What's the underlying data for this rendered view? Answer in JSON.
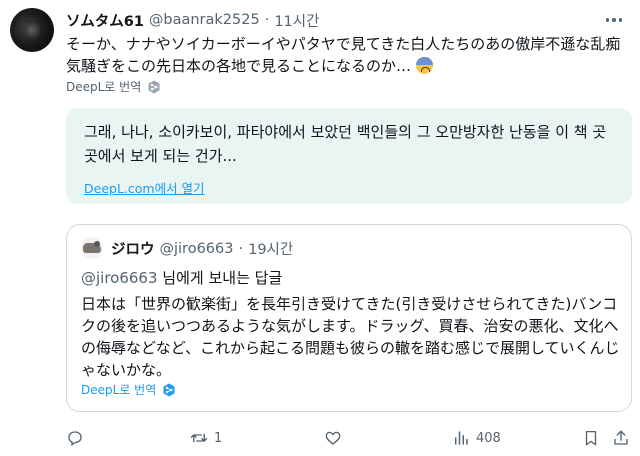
{
  "tweet": {
    "display_name": "ソムタム61",
    "handle": "@baanrak2525",
    "separator": "·",
    "time": "11시간",
    "text": "そーか、ナナやソイカーボーイやパタヤで見てきた白人たちのあの傲岸不遜な乱痴気騒ぎをこの先日本の各地で見ることになるのか…",
    "emoji": "worried-face",
    "translate_label": "DeepL로 번역"
  },
  "translation": {
    "text": "그래, 나나, 소이카보이, 파타야에서 보았던 백인들의 그 오만방자한 난동을 이 책 곳곳에서 보게 되는 건가...",
    "link_label": "DeepL.com에서 열기"
  },
  "quote": {
    "display_name": "ジロウ",
    "handle": "@jiro6663",
    "separator": "·",
    "time": "19시간",
    "reply_mention": "@jiro6663",
    "reply_suffix": " 님에게 보내는 답글",
    "text": "日本は「世界の歓楽街」を長年引き受けてきた(引き受けさせられてきた)バンコクの後を追いつつあるような気がします。ドラッグ、買春、治安の悪化、文化への侮辱などなど、これから起こる問題も彼らの轍を踏む感じで展開していくんじゃないかな。",
    "translate_label": "DeepL로 번역"
  },
  "actions": {
    "reply_count": "",
    "retweet_count": "1",
    "like_count": "",
    "view_count": "408"
  },
  "colors": {
    "text_primary": "#0f1419",
    "text_secondary": "#536471",
    "link": "#1d9bf0",
    "translation_bg": "#e8f5f3",
    "border": "#cfd9de"
  },
  "icons": [
    "more-icon",
    "deepl-icon",
    "reply-icon",
    "retweet-icon",
    "like-icon",
    "views-icon",
    "bookmark-icon",
    "share-icon"
  ]
}
